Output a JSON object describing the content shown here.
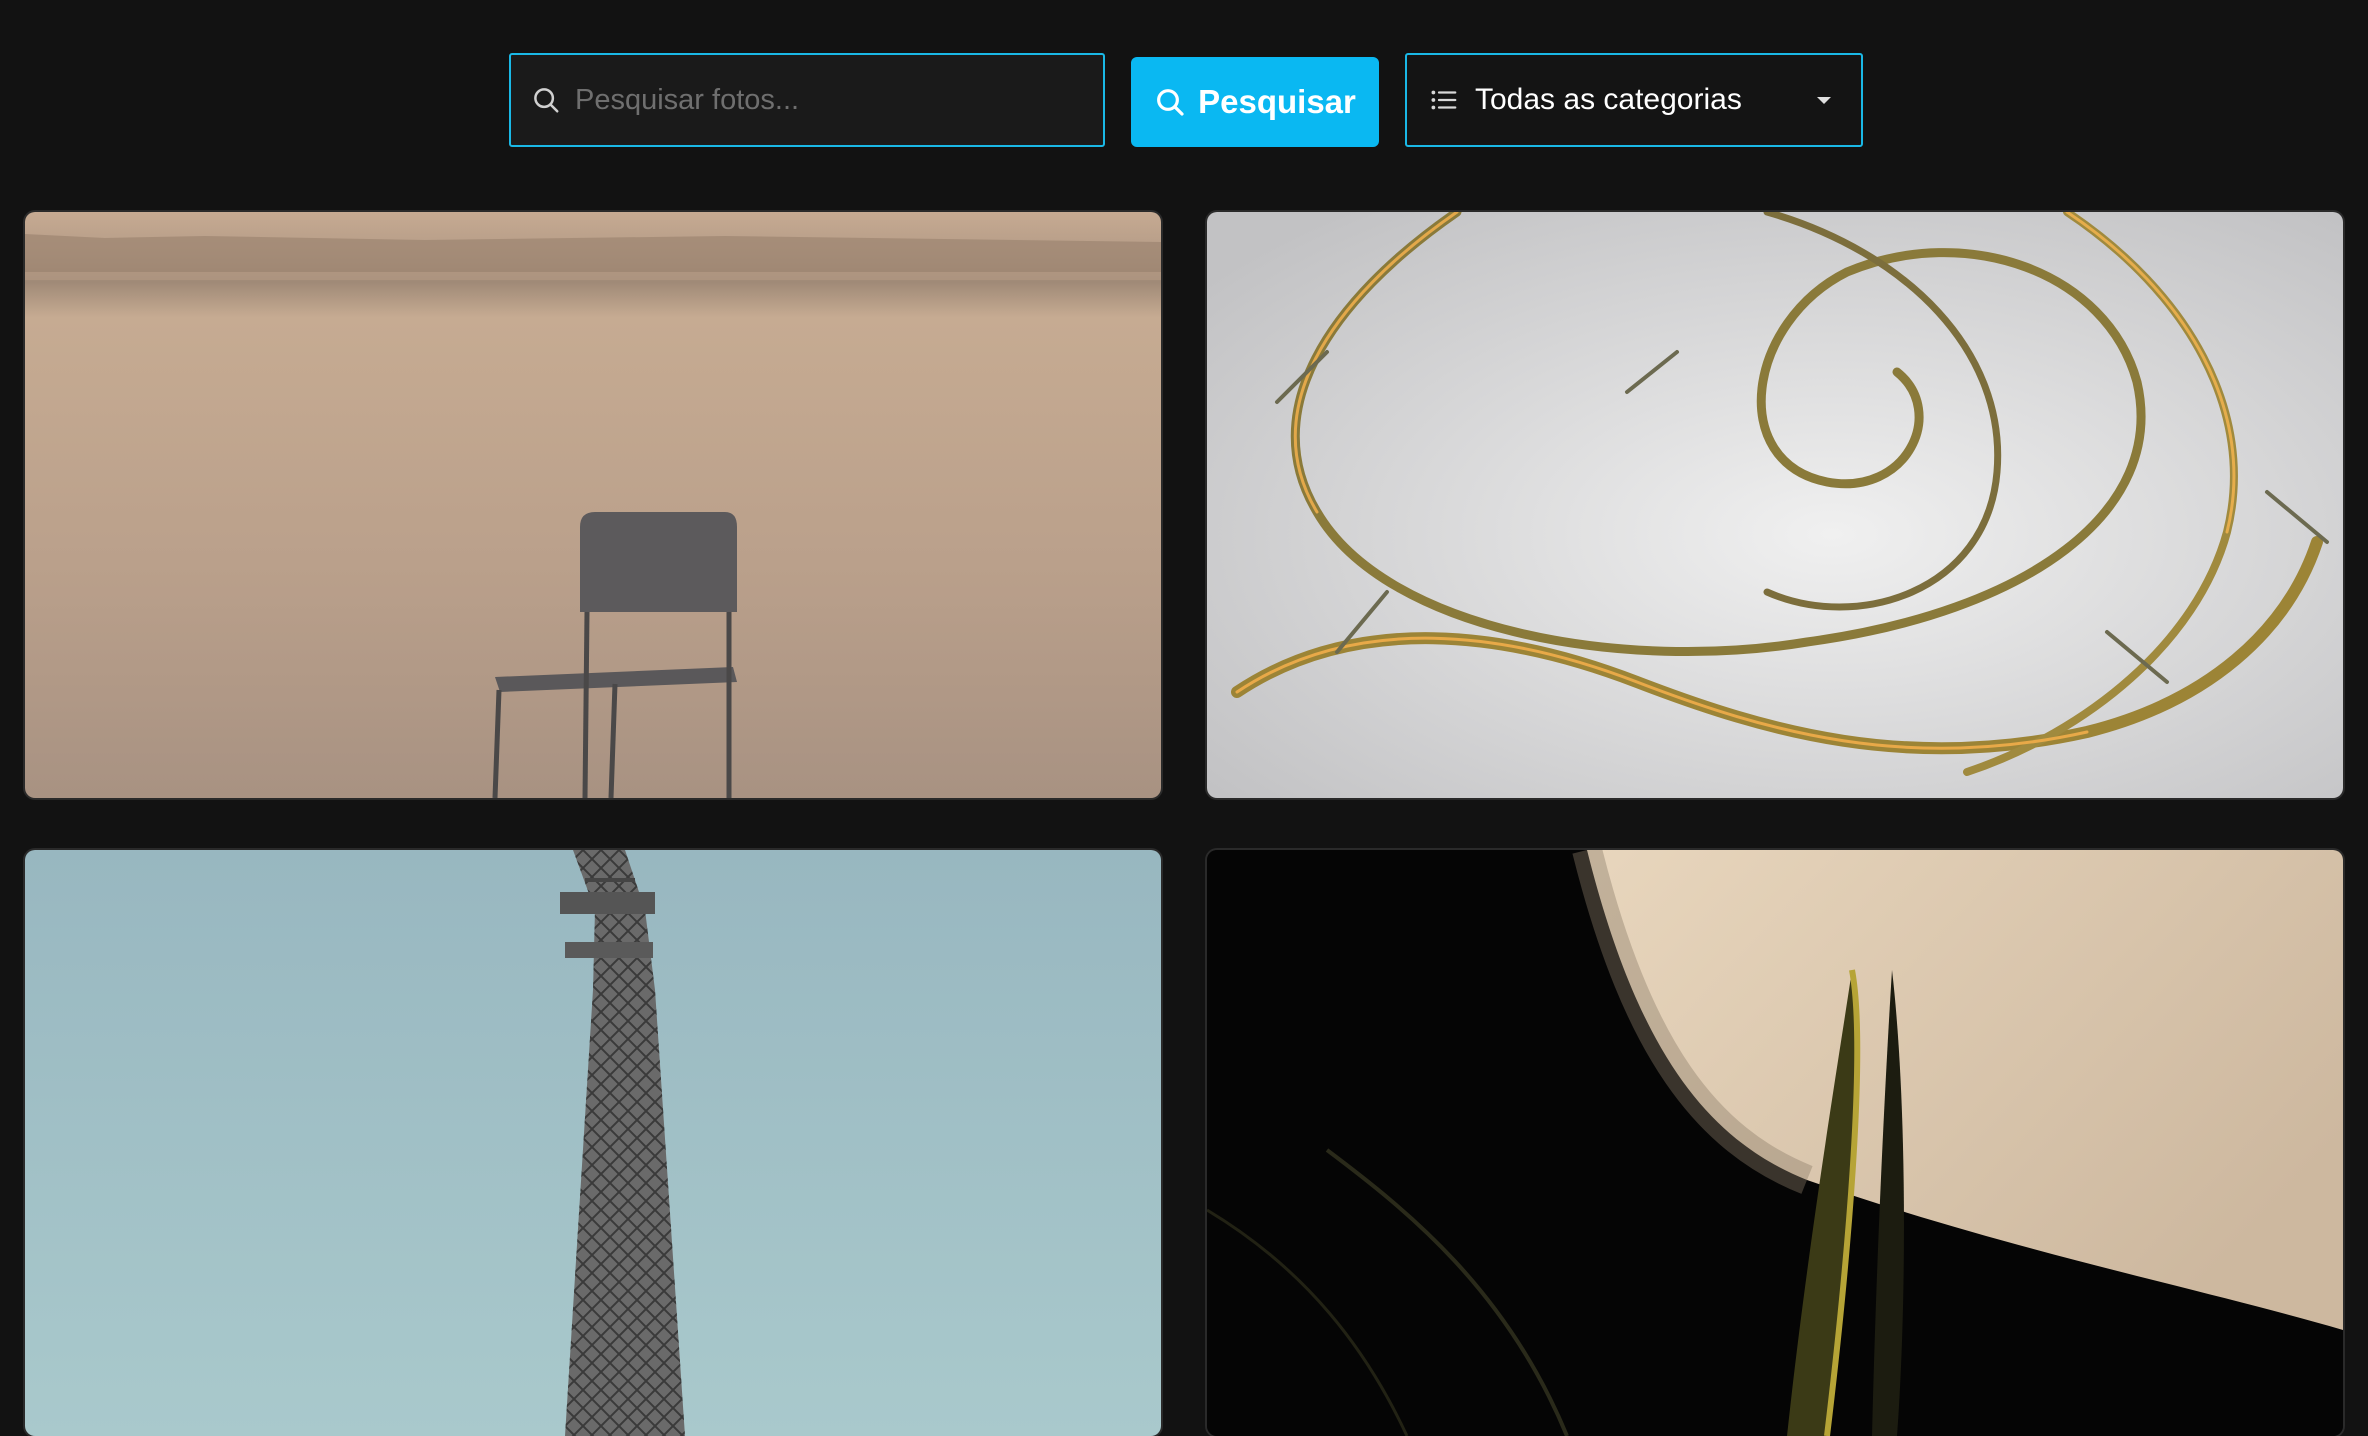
{
  "search": {
    "placeholder": "Pesquisar fotos...",
    "value": "",
    "icon": "search-icon"
  },
  "search_button": {
    "label": "Pesquisar",
    "icon": "search-icon",
    "color": "#0ab8f2"
  },
  "category_filter": {
    "selected": "Todas as categorias",
    "icon": "list-icon",
    "caret_icon": "caret-down-icon"
  },
  "gallery": {
    "photos": [
      {
        "subject": "chair-on-beach"
      },
      {
        "subject": "abstract-golden-swirl"
      },
      {
        "subject": "eiffel-tower"
      },
      {
        "subject": "plant-leaves-in-shadow"
      }
    ]
  },
  "colors": {
    "background": "#121212",
    "accent": "#0ab8f2",
    "border": "#1ab8e6"
  }
}
